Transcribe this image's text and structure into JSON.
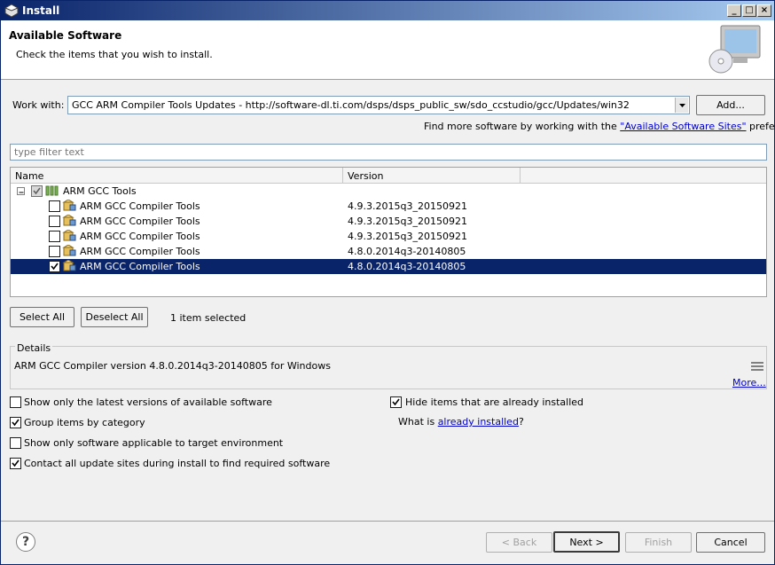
{
  "window": {
    "title": "Install"
  },
  "header": {
    "title": "Available Software",
    "description": "Check the items that you wish to install."
  },
  "work_with": {
    "label": "Work with:",
    "value": "GCC ARM Compiler Tools Updates - http://software-dl.ti.com/dsps/dsps_public_sw/sdo_ccstudio/gcc/Updates/win32",
    "add_label": "Add...",
    "find_prefix": "Find more software by working with the ",
    "find_link": "\"Available Software Sites\"",
    "find_suffix": " preferences."
  },
  "filter": {
    "placeholder": "type filter text"
  },
  "table": {
    "columns": [
      "Name",
      "Version"
    ],
    "category": "ARM GCC Tools",
    "rows": [
      {
        "name": "ARM GCC Compiler Tools",
        "version": "4.9.3.2015q3_20150921",
        "checked": false
      },
      {
        "name": "ARM GCC Compiler Tools",
        "version": "4.9.3.2015q3_20150921",
        "checked": false
      },
      {
        "name": "ARM GCC Compiler Tools",
        "version": "4.9.3.2015q3_20150921",
        "checked": false
      },
      {
        "name": "ARM GCC Compiler Tools",
        "version": "4.8.0.2014q3-20140805",
        "checked": false
      },
      {
        "name": "ARM GCC Compiler Tools",
        "version": "4.8.0.2014q3-20140805",
        "checked": true
      }
    ]
  },
  "selection": {
    "select_all": "Select All",
    "deselect_all": "Deselect All",
    "status": "1 item selected"
  },
  "details": {
    "label": "Details",
    "text": "ARM GCC Compiler version 4.8.0.2014q3-20140805 for Windows",
    "more": "More..."
  },
  "options": {
    "latest_only": "Show only the latest versions of available software",
    "group_by_category": "Group items by category",
    "target_env": "Show only software applicable to target environment",
    "contact_sites": "Contact all update sites during install to find required software",
    "hide_installed": "Hide items that are already installed",
    "what_is_prefix": "What is ",
    "what_is_link": "already installed",
    "what_is_suffix": "?"
  },
  "footer": {
    "back": "< Back",
    "next": "Next >",
    "finish": "Finish",
    "cancel": "Cancel"
  },
  "colors": {
    "selection": "#0a246a",
    "link": "#0000cc",
    "title_gradient_start": "#0a246a"
  }
}
